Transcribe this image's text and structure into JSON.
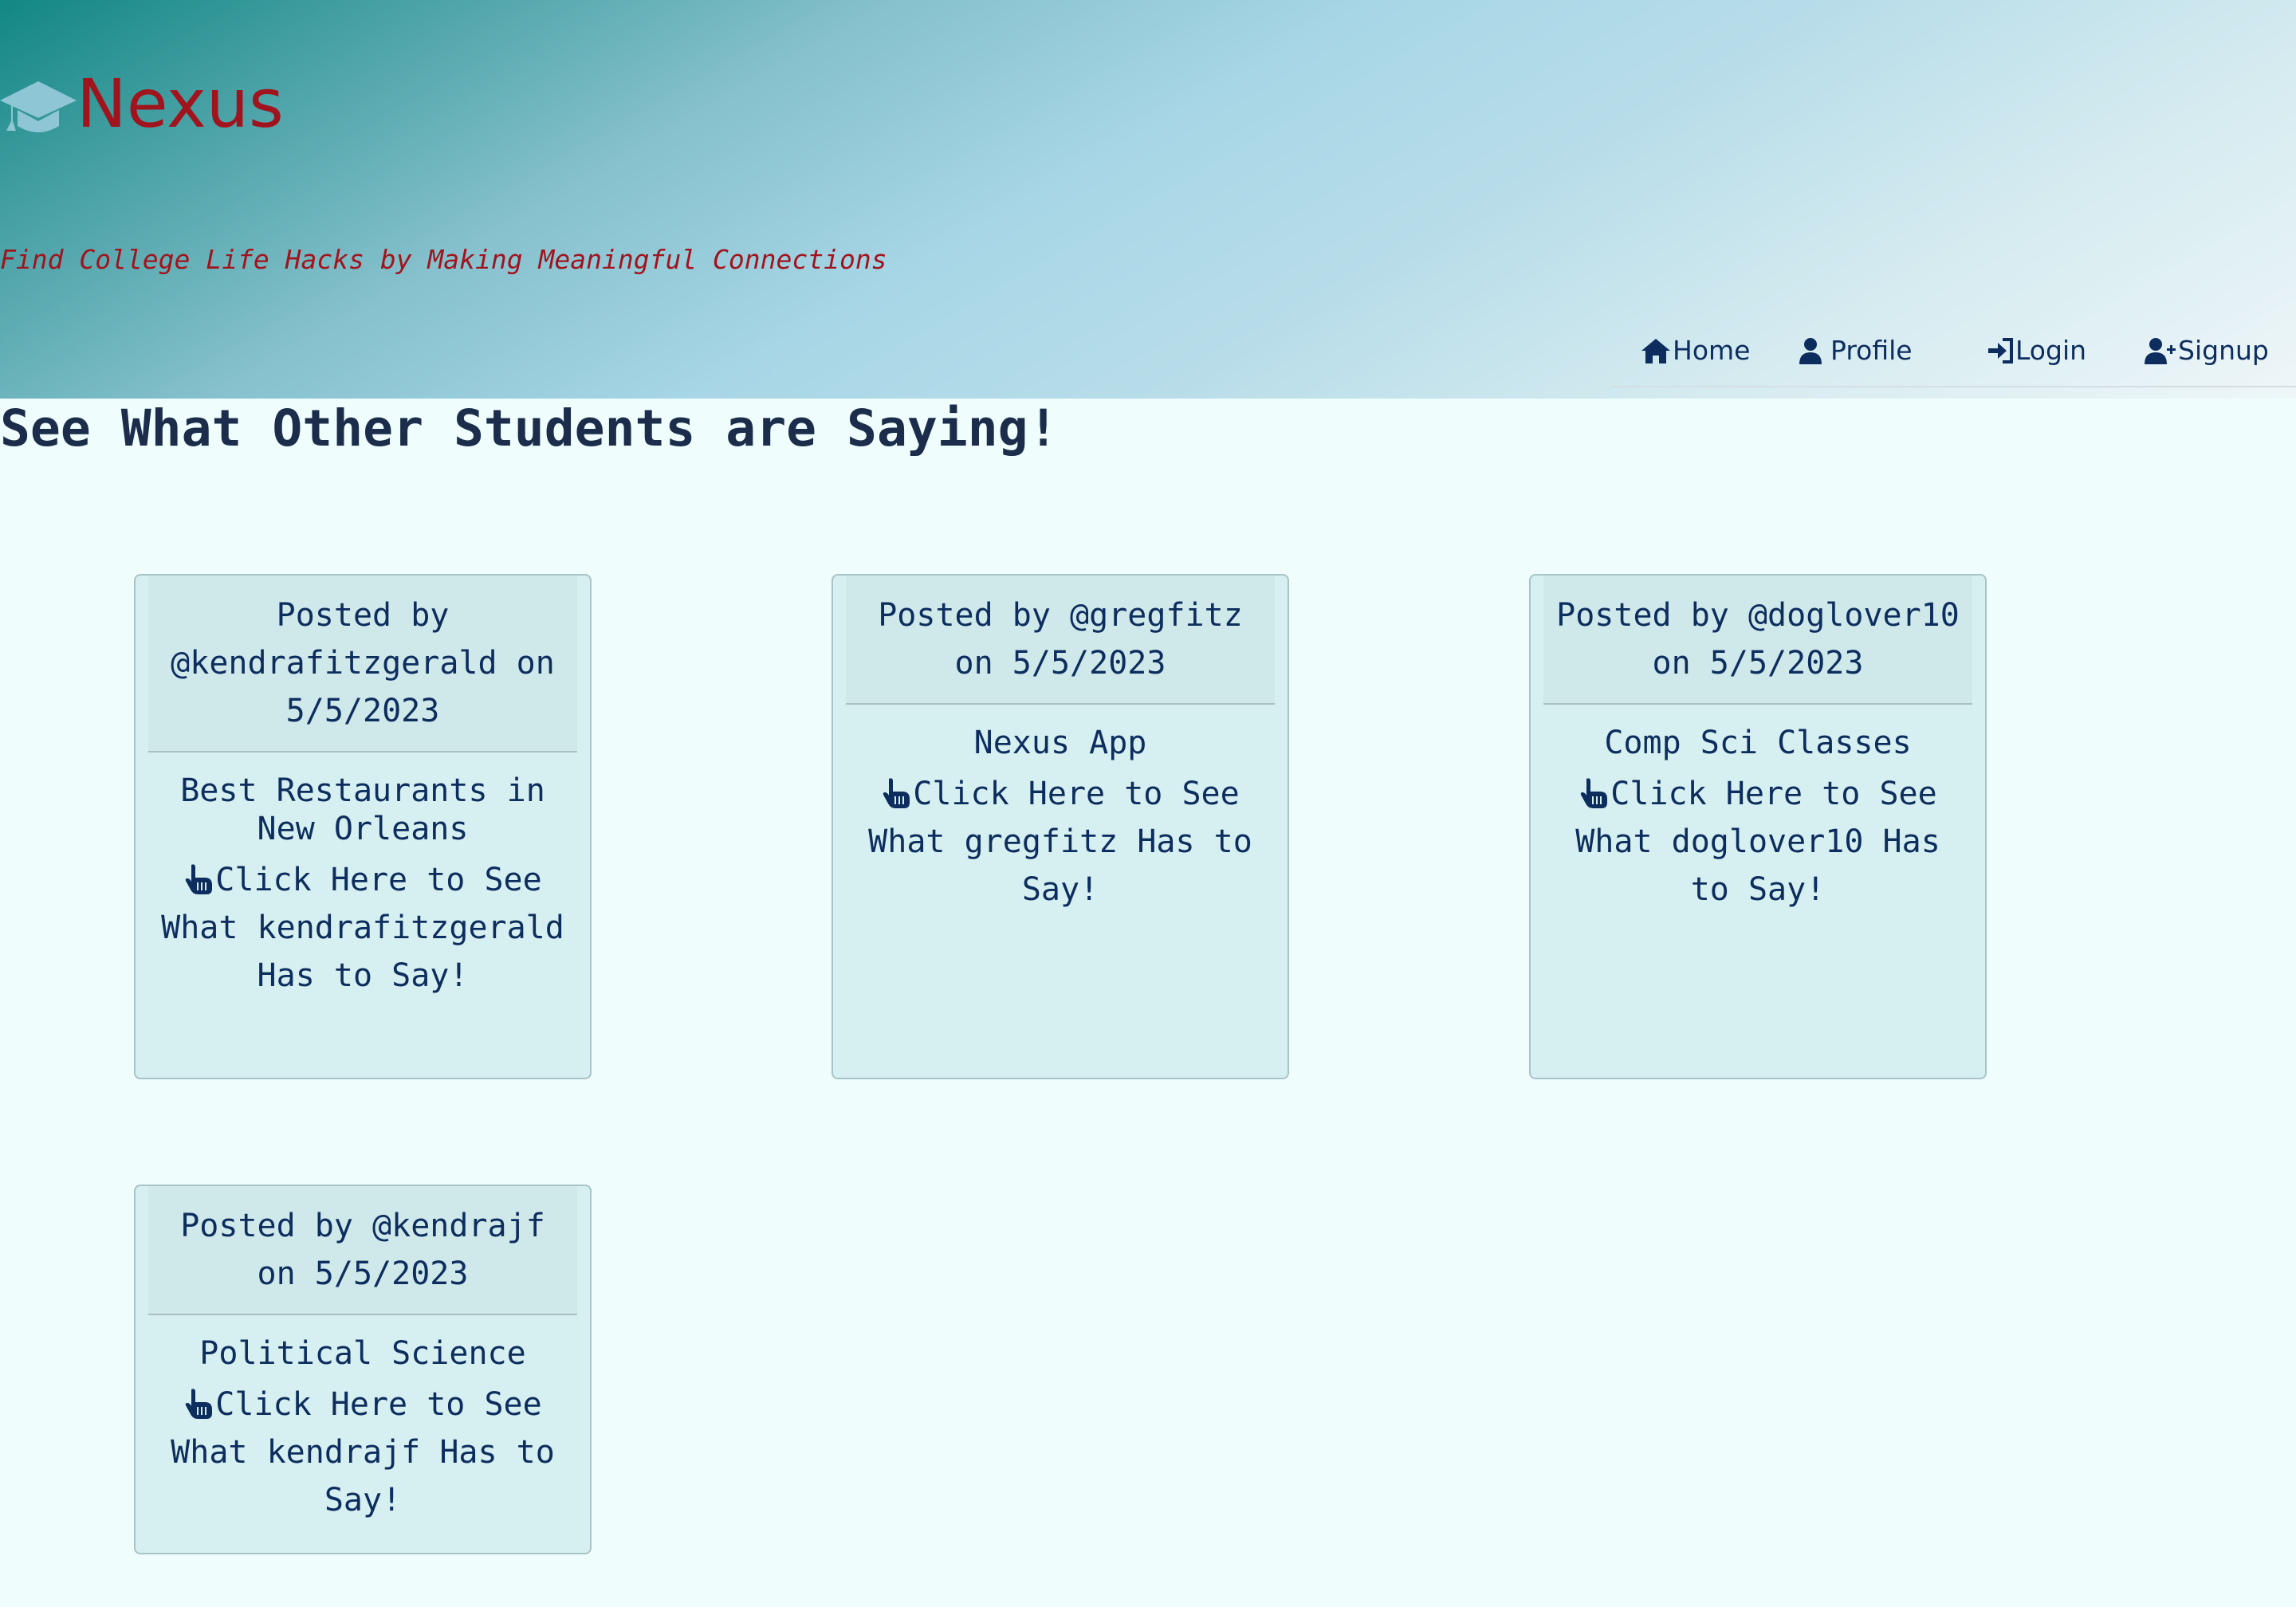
{
  "header": {
    "brand_name": "Nexus",
    "brand_icon": "graduation-cap-icon",
    "tagline": "Find College Life Hacks by Making Meaningful Connections"
  },
  "nav": {
    "items": [
      {
        "label": "Home",
        "icon": "home-icon"
      },
      {
        "label": "Profile",
        "icon": "user-icon"
      },
      {
        "label": "Login",
        "icon": "sign-in-icon"
      },
      {
        "label": "Signup",
        "icon": "user-plus-icon"
      }
    ]
  },
  "main": {
    "heading": "See What Other Students are Saying!",
    "posts": [
      {
        "header": "Posted by @kendrafitzgerald on 5/5/2023",
        "title": "Best Restaurants in New Orleans",
        "link": "Click Here to See What kendrafitzgerald Has to Say!"
      },
      {
        "header": "Posted by @gregfitz on 5/5/2023",
        "title": "Nexus App",
        "link": "Click Here to See What gregfitz Has to Say!"
      },
      {
        "header": "Posted by @doglover10 on 5/5/2023",
        "title": "Comp Sci Classes",
        "link": "Click Here to See What doglover10 Has to Say!"
      },
      {
        "header": "Posted by @kendrajf on 5/5/2023",
        "title": "Political Science",
        "link": "Click Here to See What kendrajf Has to Say!"
      }
    ]
  },
  "colors": {
    "brand_red": "#a1141e",
    "nav_navy": "#0d2d5e",
    "card_bg": "#d6eff0",
    "page_bg": "#effefd"
  }
}
